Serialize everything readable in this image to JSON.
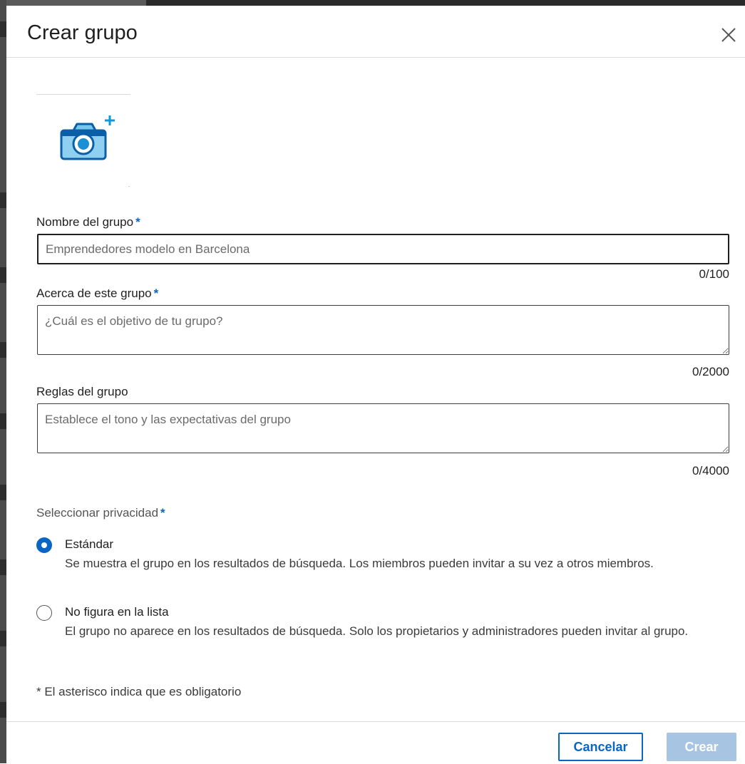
{
  "dialog": {
    "title": "Crear grupo",
    "close_icon": "close-icon"
  },
  "photo": {
    "icon": "camera-add-icon",
    "accent": "#0a66c2"
  },
  "fields": {
    "name": {
      "label": "Nombre del grupo",
      "required_mark": "*",
      "value": "",
      "placeholder": "Emprendedores modelo en Barcelona",
      "counter": "0/100"
    },
    "about": {
      "label": "Acerca de este grupo",
      "required_mark": "*",
      "value": "",
      "placeholder": "¿Cuál es el objetivo de tu grupo?",
      "counter": "0/2000"
    },
    "rules": {
      "label": "Reglas del grupo",
      "value": "",
      "placeholder": "Establece el tono y las expectativas del grupo",
      "counter": "0/4000"
    }
  },
  "privacy": {
    "label": "Seleccionar privacidad",
    "required_mark": "*",
    "options": [
      {
        "title": "Estándar",
        "description": "Se muestra el grupo en los resultados de búsqueda. Los miembros pueden invitar a su vez a otros miembros.",
        "selected": true
      },
      {
        "title": "No figura en la lista",
        "description": "El grupo no aparece en los resultados de búsqueda. Solo los propietarios y administradores pueden invitar al grupo.",
        "selected": false
      }
    ]
  },
  "footnote": "* El asterisco indica que es obligatorio",
  "footer": {
    "cancel_label": "Cancelar",
    "create_label": "Crear",
    "create_enabled": false
  },
  "colors": {
    "primary": "#0a66c2",
    "primary_disabled": "#a7c4e2",
    "border": "#3d3d3d"
  }
}
